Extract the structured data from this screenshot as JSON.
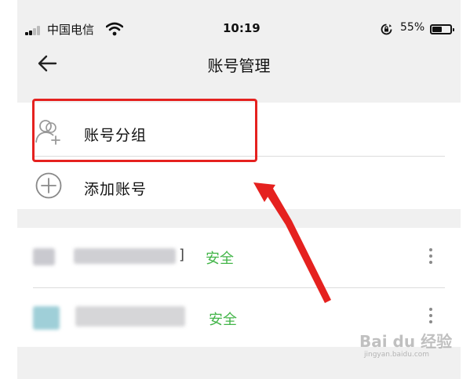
{
  "status_bar": {
    "carrier": "中国电信",
    "time": "10:19",
    "battery": "55%",
    "battery_level": 0.55,
    "icons": [
      "signal-icon",
      "wifi-icon",
      "rotation-lock-icon",
      "battery-icon"
    ]
  },
  "nav": {
    "back_icon": "back-arrow-icon",
    "title": "账号管理"
  },
  "options": [
    {
      "label": "账号分组",
      "icon": "account-group-icon"
    },
    {
      "label": "添加账号",
      "icon": "add-circle-icon"
    }
  ],
  "accounts": [
    {
      "status": "安全",
      "bracket": "]",
      "menu_icon": "more-vertical-icon"
    },
    {
      "status": "安全",
      "menu_icon": "more-vertical-icon"
    }
  ],
  "annotation": {
    "highlight_color": "#e5211f",
    "arrow_color": "#e5211f"
  },
  "watermark": {
    "brand": "Bai du 经验",
    "url": "jingyan.baidu.com"
  },
  "colors": {
    "safe_green": "#43b549",
    "page_bg": "#f0f0f0"
  }
}
